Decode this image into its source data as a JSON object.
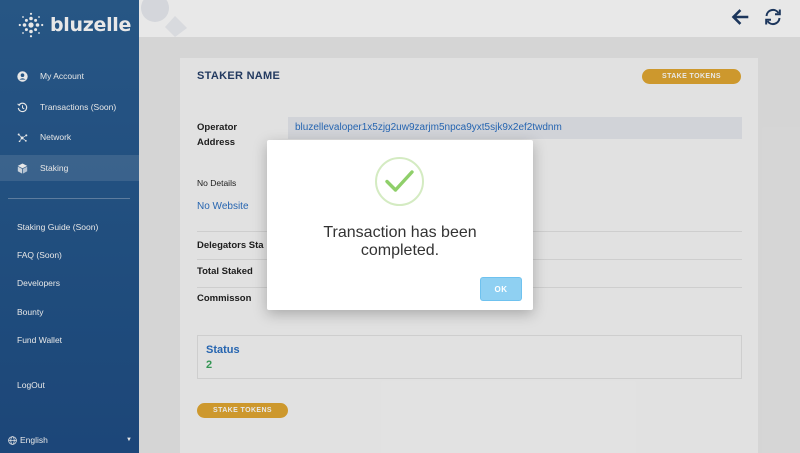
{
  "brand": {
    "name": "bluzelle"
  },
  "sidebar": {
    "nav": [
      {
        "label": "My Account",
        "icon": "user-icon"
      },
      {
        "label": "Transactions (Soon)",
        "icon": "history-icon"
      },
      {
        "label": "Network",
        "icon": "network-icon"
      },
      {
        "label": "Staking",
        "icon": "cube-icon"
      }
    ],
    "links": [
      {
        "label": "Staking Guide (Soon)"
      },
      {
        "label": "FAQ (Soon)"
      },
      {
        "label": "Developers"
      },
      {
        "label": "Bounty"
      },
      {
        "label": "Fund Wallet"
      }
    ],
    "logout": "LogOut",
    "language": "English"
  },
  "topbar": {
    "back_icon": "arrow-left-icon",
    "refresh_icon": "refresh-icon"
  },
  "validator": {
    "title": "STAKER NAME",
    "stake_button": "STAKE TOKENS",
    "operator_label": "Operator Address",
    "operator_address": "bluzellevaloper1x5zjg2uw9zarjm5npca9yxt5sjk9x2ef2twdnm",
    "details": "No Details",
    "website": "No Website",
    "delegators_label": "Delegators Sta",
    "total_staked_label": "Total Staked",
    "commission_label": "Commisson",
    "status_label": "Status",
    "status_value": "2",
    "stake_button_bottom": "STAKE TOKENS"
  },
  "modal": {
    "message": "Transaction has been completed.",
    "ok": "OK",
    "icon": "check-icon"
  },
  "colors": {
    "sidebar": "#1f4e85",
    "accent": "#e2a832",
    "link": "#2a6fc2",
    "success": "#3aa55d",
    "ok": "#8fd0f2"
  }
}
